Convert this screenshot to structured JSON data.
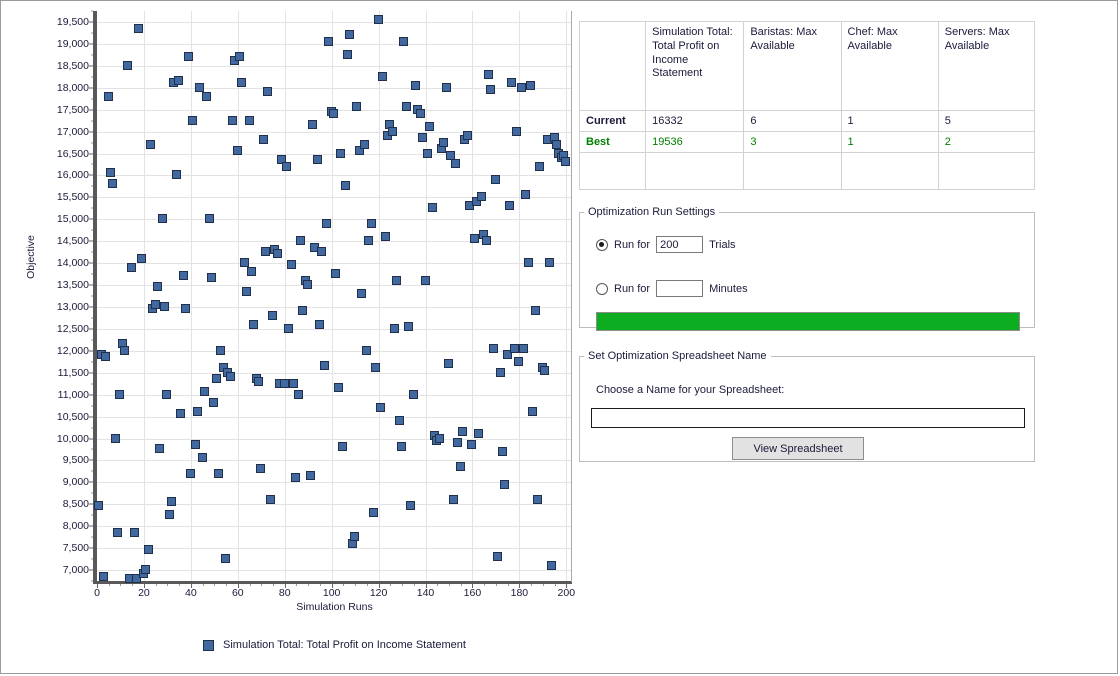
{
  "results_table": {
    "headers": [
      "",
      "Simulation Total: Total Profit on Income Statement",
      "Baristas: Max Available",
      "Chef: Max Available",
      "Servers: Max Available"
    ],
    "rows": [
      {
        "label": "Current",
        "objective": "16332",
        "baristas": "6",
        "chef": "1",
        "servers": "5"
      },
      {
        "label": "Best",
        "objective": "19536",
        "baristas": "3",
        "chef": "1",
        "servers": "2"
      }
    ],
    "best_color": "#008000"
  },
  "run_settings": {
    "title": "Optimization Run Settings",
    "trials_prefix": "Run for",
    "trials_value": "200",
    "trials_suffix": "Trials",
    "minutes_prefix": "Run for",
    "minutes_value": "",
    "minutes_suffix": "Minutes",
    "selected": "trials",
    "progress_color": "#0dad22",
    "progress_percent": 100
  },
  "spreadsheet": {
    "title": "Set Optimization Spreadsheet Name",
    "label": "Choose a Name for your Spreadsheet:",
    "input_value": "",
    "button_label": "View Spreadsheet"
  },
  "chart_data": {
    "type": "scatter",
    "title": "",
    "xlabel": "Simulation Runs",
    "ylabel": "Objective",
    "xlim": [
      0,
      202
    ],
    "ylim": [
      6750,
      19750
    ],
    "xticks": [
      0,
      20,
      40,
      60,
      80,
      100,
      120,
      140,
      160,
      180,
      200
    ],
    "yticks": [
      7000,
      7500,
      8000,
      8500,
      9000,
      9500,
      10000,
      10500,
      11000,
      11500,
      12000,
      12500,
      13000,
      13500,
      14000,
      14500,
      15000,
      15500,
      16000,
      16500,
      17000,
      17500,
      18000,
      18500,
      19000,
      19500
    ],
    "ytick_labels": [
      "7,000",
      "7,500",
      "8,000",
      "8,500",
      "9,000",
      "9,500",
      "10,000",
      "10,500",
      "11,000",
      "11,500",
      "12,000",
      "12,500",
      "13,000",
      "13,500",
      "14,000",
      "14,500",
      "15,000",
      "15,500",
      "16,000",
      "16,500",
      "17,000",
      "17,500",
      "18,000",
      "18,500",
      "19,000",
      "19,500"
    ],
    "grid": true,
    "legend_position": "bottom",
    "legend": [
      "Simulation Total: Total Profit on Income Statement"
    ],
    "marker": {
      "shape": "square",
      "fill": "#41699f",
      "edge": "#20304a",
      "size": 9
    },
    "series": [
      {
        "name": "Simulation Total: Total Profit on Income Statement",
        "points": [
          [
            1,
            8450
          ],
          [
            2,
            11900
          ],
          [
            3,
            6850
          ],
          [
            4,
            11850
          ],
          [
            5,
            17800
          ],
          [
            6,
            16050
          ],
          [
            7,
            15800
          ],
          [
            8,
            10000
          ],
          [
            9,
            7850
          ],
          [
            10,
            11000
          ],
          [
            11,
            12150
          ],
          [
            12,
            12000
          ],
          [
            13,
            18500
          ],
          [
            14,
            6800
          ],
          [
            15,
            13900
          ],
          [
            16,
            7850
          ],
          [
            17,
            6800
          ],
          [
            18,
            19350
          ],
          [
            19,
            14100
          ],
          [
            20,
            6900
          ],
          [
            21,
            7000
          ],
          [
            22,
            7450
          ],
          [
            23,
            16700
          ],
          [
            24,
            12950
          ],
          [
            25,
            13050
          ],
          [
            26,
            13450
          ],
          [
            27,
            9750
          ],
          [
            28,
            15000
          ],
          [
            29,
            13000
          ],
          [
            30,
            11000
          ],
          [
            31,
            8250
          ],
          [
            32,
            8550
          ],
          [
            33,
            18100
          ],
          [
            34,
            16000
          ],
          [
            35,
            18150
          ],
          [
            36,
            10550
          ],
          [
            37,
            13700
          ],
          [
            38,
            12950
          ],
          [
            39,
            18700
          ],
          [
            40,
            9200
          ],
          [
            41,
            17250
          ],
          [
            42,
            9850
          ],
          [
            43,
            10600
          ],
          [
            44,
            18000
          ],
          [
            45,
            9550
          ],
          [
            46,
            11050
          ],
          [
            47,
            17800
          ],
          [
            48,
            15000
          ],
          [
            49,
            13650
          ],
          [
            50,
            10800
          ],
          [
            51,
            11350
          ],
          [
            52,
            9200
          ],
          [
            53,
            12000
          ],
          [
            54,
            11600
          ],
          [
            55,
            7250
          ],
          [
            56,
            11500
          ],
          [
            57,
            11400
          ],
          [
            58,
            17250
          ],
          [
            59,
            18600
          ],
          [
            60,
            16550
          ],
          [
            61,
            18700
          ],
          [
            62,
            18100
          ],
          [
            63,
            14000
          ],
          [
            64,
            13350
          ],
          [
            65,
            17250
          ],
          [
            66,
            13800
          ],
          [
            67,
            12600
          ],
          [
            68,
            11350
          ],
          [
            69,
            11300
          ],
          [
            70,
            9300
          ],
          [
            71,
            16800
          ],
          [
            72,
            14250
          ],
          [
            73,
            17900
          ],
          [
            74,
            8600
          ],
          [
            75,
            12800
          ],
          [
            76,
            14300
          ],
          [
            77,
            14200
          ],
          [
            78,
            11250
          ],
          [
            79,
            16350
          ],
          [
            80,
            11250
          ],
          [
            81,
            16200
          ],
          [
            82,
            12500
          ],
          [
            83,
            13950
          ],
          [
            84,
            11250
          ],
          [
            85,
            9100
          ],
          [
            86,
            11000
          ],
          [
            87,
            14500
          ],
          [
            88,
            12900
          ],
          [
            89,
            13600
          ],
          [
            90,
            13500
          ],
          [
            91,
            9150
          ],
          [
            92,
            17150
          ],
          [
            93,
            14350
          ],
          [
            94,
            16350
          ],
          [
            95,
            12600
          ],
          [
            96,
            14250
          ],
          [
            97,
            11650
          ],
          [
            98,
            14900
          ],
          [
            99,
            19050
          ],
          [
            100,
            17450
          ],
          [
            101,
            17400
          ],
          [
            102,
            13750
          ],
          [
            103,
            11150
          ],
          [
            104,
            16500
          ],
          [
            105,
            9800
          ],
          [
            106,
            15750
          ],
          [
            107,
            18750
          ],
          [
            108,
            19200
          ],
          [
            109,
            7600
          ],
          [
            110,
            7750
          ],
          [
            111,
            17550
          ],
          [
            112,
            16550
          ],
          [
            113,
            13300
          ],
          [
            114,
            16700
          ],
          [
            115,
            12000
          ],
          [
            116,
            14500
          ],
          [
            117,
            14900
          ],
          [
            118,
            8300
          ],
          [
            119,
            11600
          ],
          [
            120,
            19550
          ],
          [
            121,
            10700
          ],
          [
            122,
            18250
          ],
          [
            123,
            14600
          ],
          [
            124,
            16900
          ],
          [
            125,
            17150
          ],
          [
            126,
            17000
          ],
          [
            127,
            12500
          ],
          [
            128,
            13600
          ],
          [
            129,
            10400
          ],
          [
            130,
            9800
          ],
          [
            131,
            19050
          ],
          [
            132,
            17550
          ],
          [
            133,
            12550
          ],
          [
            134,
            8450
          ],
          [
            135,
            11000
          ],
          [
            136,
            18050
          ],
          [
            137,
            17500
          ],
          [
            138,
            17400
          ],
          [
            139,
            16850
          ],
          [
            140,
            13600
          ],
          [
            141,
            16500
          ],
          [
            142,
            17100
          ],
          [
            143,
            15250
          ],
          [
            144,
            10050
          ],
          [
            145,
            9950
          ],
          [
            146,
            10000
          ],
          [
            147,
            16600
          ],
          [
            148,
            16750
          ],
          [
            149,
            18000
          ],
          [
            150,
            11700
          ],
          [
            151,
            16450
          ],
          [
            152,
            8600
          ],
          [
            153,
            16250
          ],
          [
            154,
            9900
          ],
          [
            155,
            9350
          ],
          [
            156,
            10150
          ],
          [
            157,
            16800
          ],
          [
            158,
            16900
          ],
          [
            159,
            15300
          ],
          [
            160,
            9850
          ],
          [
            161,
            14550
          ],
          [
            162,
            15400
          ],
          [
            163,
            10100
          ],
          [
            164,
            15500
          ],
          [
            165,
            14650
          ],
          [
            166,
            14500
          ],
          [
            167,
            18300
          ],
          [
            168,
            17950
          ],
          [
            169,
            12050
          ],
          [
            170,
            15900
          ],
          [
            171,
            7300
          ],
          [
            172,
            11500
          ],
          [
            173,
            9700
          ],
          [
            174,
            8950
          ],
          [
            175,
            11900
          ],
          [
            176,
            15300
          ],
          [
            177,
            18100
          ],
          [
            178,
            12050
          ],
          [
            179,
            17000
          ],
          [
            180,
            11750
          ],
          [
            181,
            18000
          ],
          [
            182,
            12050
          ],
          [
            183,
            15550
          ],
          [
            184,
            14000
          ],
          [
            185,
            18050
          ],
          [
            186,
            10600
          ],
          [
            187,
            12900
          ],
          [
            188,
            8600
          ],
          [
            189,
            16200
          ],
          [
            190,
            11600
          ],
          [
            191,
            11550
          ],
          [
            192,
            16800
          ],
          [
            193,
            14000
          ],
          [
            194,
            7100
          ],
          [
            195,
            16850
          ],
          [
            196,
            16700
          ],
          [
            197,
            16500
          ],
          [
            198,
            16400
          ],
          [
            199,
            16450
          ],
          [
            200,
            16300
          ]
        ]
      }
    ]
  }
}
